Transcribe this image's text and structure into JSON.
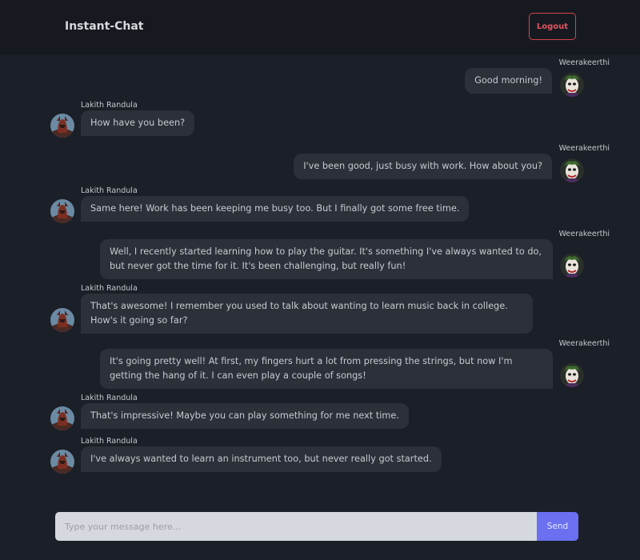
{
  "header": {
    "title": "Instant-Chat",
    "logout_label": "Logout"
  },
  "messages": [
    {
      "sender": "Weerakeerthi",
      "text": "Good morning!",
      "avatar": "joker-avatar"
    },
    {
      "sender": "Lakith Randula",
      "text": "How have you been?",
      "avatar": "knight-avatar"
    },
    {
      "sender": "Weerakeerthi",
      "text": "I've been good, just busy with work. How about you?",
      "avatar": "joker-avatar"
    },
    {
      "sender": "Lakith Randula",
      "text": "Same here! Work has been keeping me busy too. But I finally got some free time.",
      "avatar": "knight-avatar"
    },
    {
      "sender": "Weerakeerthi",
      "text": "Well, I recently started learning how to play the guitar. It's something I've always wanted to do, but never got the time for it. It's been challenging, but really fun!",
      "avatar": "joker-avatar"
    },
    {
      "sender": "Lakith Randula",
      "text": "That's awesome! I remember you used to talk about wanting to learn music back in college. How's it going so far?",
      "avatar": "knight-avatar"
    },
    {
      "sender": "Weerakeerthi",
      "text": "It's going pretty well! At first, my fingers hurt a lot from pressing the strings, but now I'm getting the hang of it. I can even play a couple of songs!",
      "avatar": "joker-avatar"
    },
    {
      "sender": "Lakith Randula",
      "text": "That's impressive! Maybe you can play something for me next time.",
      "avatar": "knight-avatar"
    },
    {
      "sender": "Lakith Randula",
      "text": "I've always wanted to learn an instrument too, but never really got started.",
      "avatar": "knight-avatar"
    }
  ],
  "composer": {
    "placeholder": "Type your message here...",
    "value": "",
    "send_label": "Send"
  }
}
